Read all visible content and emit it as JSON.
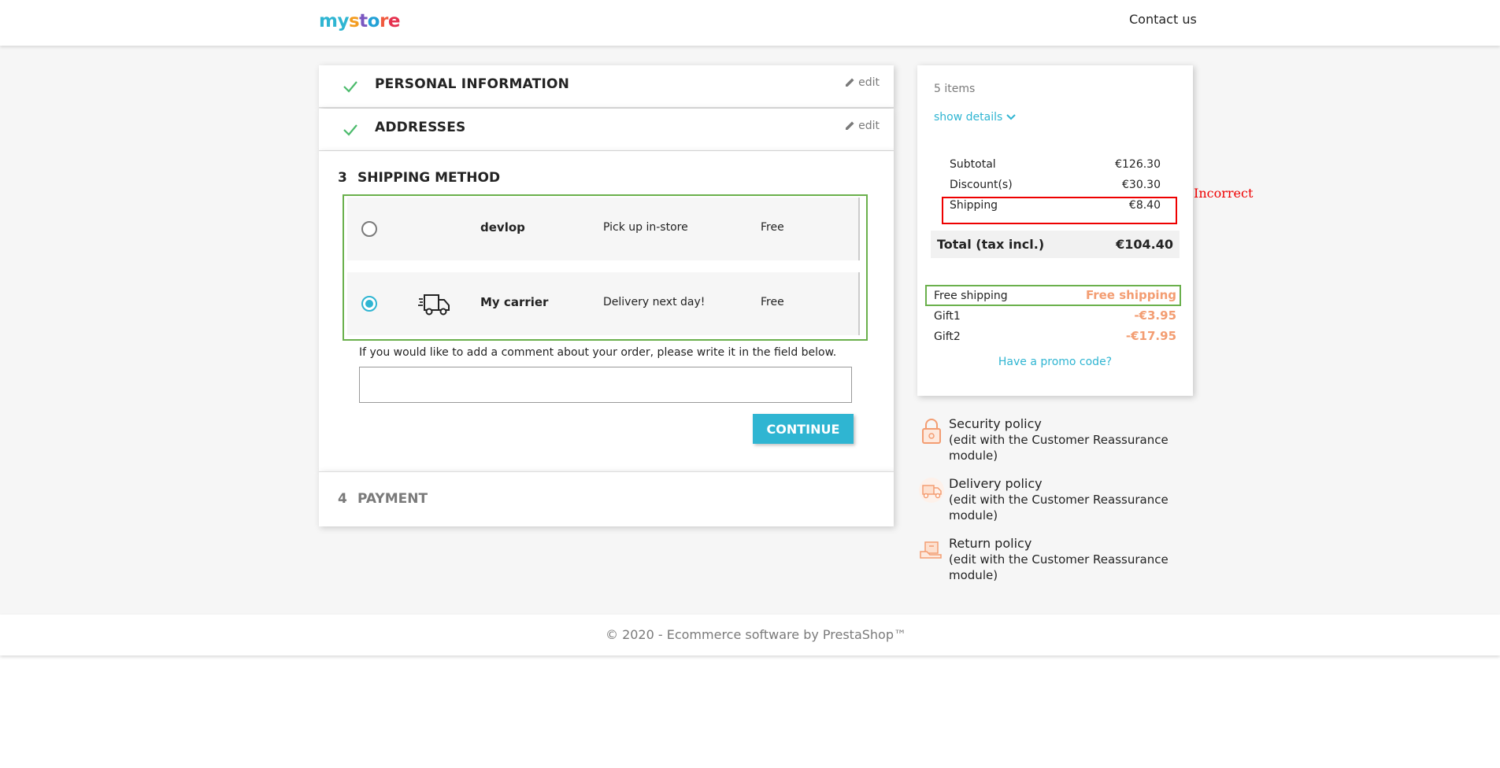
{
  "header": {
    "logo": [
      "my",
      " ",
      "s",
      "t",
      "o",
      "r",
      "e"
    ],
    "contact": "Contact us"
  },
  "steps": {
    "personal": {
      "title": "PERSONAL INFORMATION",
      "edit": "edit"
    },
    "addresses": {
      "title": "ADDRESSES",
      "edit": "edit"
    },
    "shipping": {
      "num": "3",
      "title": "SHIPPING METHOD",
      "carriers": [
        {
          "name": "devlop",
          "delay": "Pick up in-store",
          "price": "Free",
          "selected": false
        },
        {
          "name": "My carrier",
          "delay": "Delivery next day!",
          "price": "Free",
          "selected": true
        }
      ],
      "comment_label": "If you would like to add a comment about your order, please write it in the field below.",
      "comment_value": "",
      "continue": "CONTINUE"
    },
    "payment": {
      "num": "4",
      "title": "PAYMENT"
    }
  },
  "summary": {
    "items": "5 items",
    "show_details": "show details",
    "subtotal": {
      "label": "Subtotal",
      "value": "€126.30"
    },
    "discounts": {
      "label": "Discount(s)",
      "value": "€30.30"
    },
    "shipping": {
      "label": "Shipping",
      "value": "€8.40"
    },
    "total": {
      "label": "Total (tax incl.)",
      "value": "€104.40"
    },
    "vouchers": [
      {
        "label": "Free shipping",
        "value": "Free shipping"
      },
      {
        "label": "Gift1",
        "value": "-€3.95"
      },
      {
        "label": "Gift2",
        "value": "-€17.95"
      }
    ],
    "promo": "Have a promo code?"
  },
  "annotation": {
    "incorrect": "Incorrect"
  },
  "reassurance": [
    {
      "title": "Security policy",
      "text": "(edit with the Customer Reassurance module)",
      "icon": "lock-icon"
    },
    {
      "title": "Delivery policy",
      "text": "(edit with the Customer Reassurance module)",
      "icon": "delivery-truck-icon"
    },
    {
      "title": "Return policy",
      "text": "(edit with the Customer Reassurance module)",
      "icon": "return-box-icon"
    }
  ],
  "footer": {
    "text": "© 2020 - Ecommerce software by PrestaShop™"
  },
  "colors": {
    "accent": "#2fb5d2",
    "voucher": "#f39d72",
    "annotation_red": "#e00000",
    "annotation_green": "#6ab04c",
    "check": "#4cbb6c"
  }
}
